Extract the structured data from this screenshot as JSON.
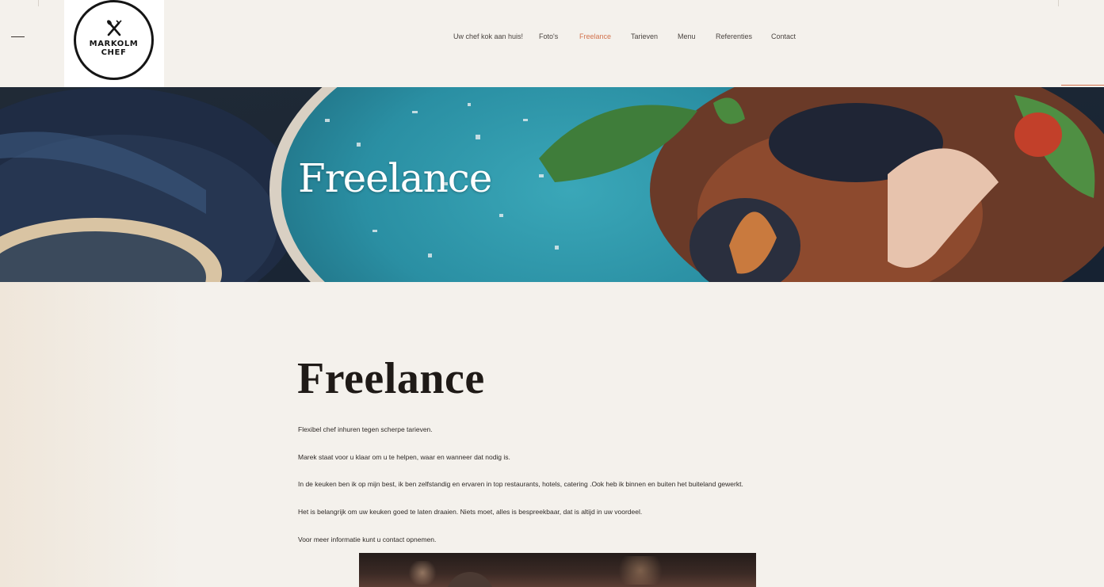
{
  "brand": {
    "logo_line1": "MARKOLM",
    "logo_line2": "CHEF"
  },
  "nav": {
    "items": [
      {
        "label": "Uw chef kok aan huis!"
      },
      {
        "label": "Foto's"
      },
      {
        "label": "Freelance"
      },
      {
        "label": "Tarieven"
      },
      {
        "label": "Menu"
      },
      {
        "label": "Referenties"
      },
      {
        "label": "Contact"
      }
    ],
    "active": "Freelance"
  },
  "hero": {
    "title": "Freelance"
  },
  "content": {
    "title": "Freelance",
    "paragraphs": [
      "Flexibel chef inhuren tegen scherpe tarieven.",
      "Marek staat voor u klaar om u te helpen, waar en wanneer dat nodig is.",
      "In de keuken ben ik op mijn best, ik ben zelfstandig en ervaren in top restaurants, hotels, catering .Ook heb ik binnen en buiten het buiteland gewerkt.",
      "Het is belangrijk om uw keuken goed te laten draaien. Niets moet, alles is bespreekbaar, dat is altijd in uw voordeel.",
      "Voor meer informatie kunt u contact opnemen."
    ]
  },
  "colors": {
    "background": "#f4f1ec",
    "accent": "#d2734e",
    "text": "#2a2522"
  },
  "icons": {
    "logo": "fork-knife-crossed-icon",
    "menu": "hamburger-menu-icon"
  }
}
